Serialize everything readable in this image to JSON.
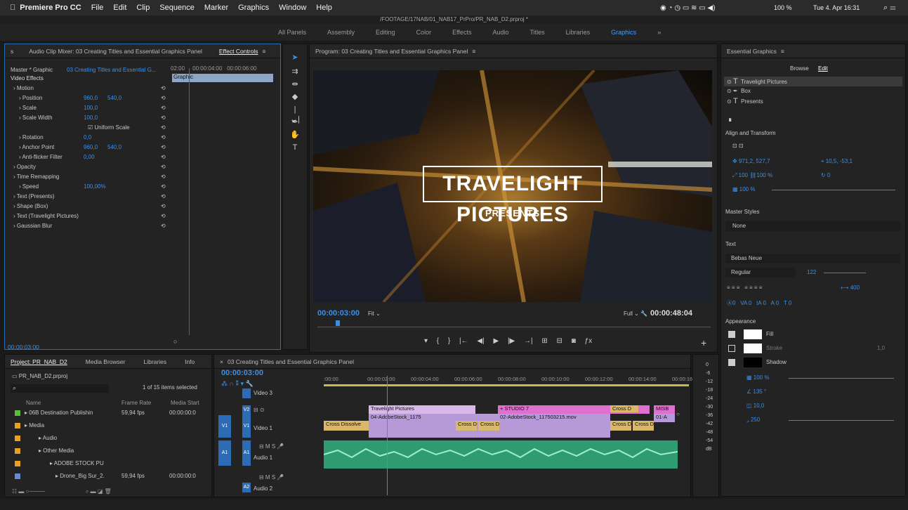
{
  "menubar": {
    "apple": "",
    "app": "Premiere Pro CC",
    "items": [
      "File",
      "Edit",
      "Clip",
      "Sequence",
      "Marker",
      "Graphics",
      "Window",
      "Help"
    ],
    "status": "100 %",
    "datetime": "Tue 4. Apr 16:31"
  },
  "titlebar": {
    "path": "/FOOTAGE/17NAB/01_NAB17_PrPro/PR_NAB_D2.prproj *"
  },
  "workspaces": [
    "All Panels",
    "Assembly",
    "Editing",
    "Color",
    "Effects",
    "Audio",
    "Titles",
    "Libraries",
    "Graphics"
  ],
  "effect_controls": {
    "tabs": [
      "s",
      "Audio Clip Mixer: 03 Creating Titles and Essential Graphics Panel",
      "Effect Controls"
    ],
    "master": "Master * Graphic",
    "seq": "03 Creating Titles and Essential G...",
    "times": [
      "02:00",
      "00:00:04:00",
      "00:00:06:00"
    ],
    "clip_label": "Graphic",
    "section": "Video Effects",
    "rows": [
      {
        "label": "Motion",
        "v1": "",
        "v2": ""
      },
      {
        "label": "Position",
        "v1": "960,0",
        "v2": "540,0"
      },
      {
        "label": "Scale",
        "v1": "100,0",
        "v2": ""
      },
      {
        "label": "Scale Width",
        "v1": "100,0",
        "v2": ""
      },
      {
        "label": "",
        "v1": "Uniform Scale",
        "v2": ""
      },
      {
        "label": "Rotation",
        "v1": "0,0",
        "v2": ""
      },
      {
        "label": "Anchor Point",
        "v1": "960,0",
        "v2": "540,0"
      },
      {
        "label": "Anti-flicker Filter",
        "v1": "0,00",
        "v2": ""
      },
      {
        "label": "Opacity",
        "v1": "",
        "v2": ""
      },
      {
        "label": "Time Remapping",
        "v1": "",
        "v2": ""
      },
      {
        "label": "Speed",
        "v1": "100,00%",
        "v2": ""
      },
      {
        "label": "Text (Presents)",
        "v1": "",
        "v2": ""
      },
      {
        "label": "Shape (Box)",
        "v1": "",
        "v2": ""
      },
      {
        "label": "Text (Travelight Pictures)",
        "v1": "",
        "v2": ""
      },
      {
        "label": "Gaussian Blur",
        "v1": "",
        "v2": ""
      }
    ],
    "timecode": "00:00:03:00"
  },
  "program": {
    "title": "Program: 03 Creating Titles and Essential Graphics Panel",
    "title_text": "TRAVELIGHT PICTURES",
    "sub_text": "PRESENTS",
    "timecode": "00:00:03:00",
    "fit": "Fit",
    "full": "Full",
    "duration": "00:00:48:04"
  },
  "essential": {
    "title": "Essential Graphics",
    "tabs": [
      "Browse",
      "Edit"
    ],
    "layers": [
      "Travelight Pictures",
      "Box",
      "Presents"
    ],
    "align_title": "Align and Transform",
    "pos": [
      "971,2",
      "527,7"
    ],
    "anchor": [
      "10,5",
      "-53,1"
    ],
    "scale": "100",
    "scale2": "100",
    "pct": "%",
    "rot": "0",
    "opacity": "100 %",
    "master_styles": "Master Styles",
    "style_val": "None",
    "text_title": "Text",
    "font": "Bebas Neue",
    "weight": "Regular",
    "size": "122",
    "tracking": "400",
    "kern": [
      "0",
      "0",
      "0",
      "0",
      "0"
    ],
    "appearance": "Appearance",
    "fill": "Fill",
    "stroke": "Stroke",
    "stroke_w": "1,0",
    "shadow": "Shadow",
    "shadow_vals": [
      "100 %",
      "135 °",
      "10,0",
      "250"
    ]
  },
  "project": {
    "tabs": [
      "Project: PR_NAB_D2",
      "Media Browser",
      "Libraries",
      "Info"
    ],
    "file": "PR_NAB_D2.prproj",
    "count": "1 of 15 items selected",
    "cols": [
      "Name",
      "Frame Rate",
      "Media Start"
    ],
    "items": [
      {
        "name": "06B Destination Publishin",
        "rate": "59,94 fps",
        "start": "00:00:00:0",
        "color": "#5bbd3a"
      },
      {
        "name": "Media",
        "rate": "",
        "start": "",
        "color": "#e8a020"
      },
      {
        "name": "Audio",
        "rate": "",
        "start": "",
        "color": "#e8a020"
      },
      {
        "name": "Other Media",
        "rate": "",
        "start": "",
        "color": "#e8a020"
      },
      {
        "name": "ADOBE STOCK PU",
        "rate": "",
        "start": "",
        "color": "#e8a020"
      },
      {
        "name": "Drone_Big Sur_2.",
        "rate": "59,94 fps",
        "start": "00:00:00:0",
        "color": "#6a8ad8"
      }
    ]
  },
  "timeline": {
    "title": "03 Creating Titles and Essential Graphics Panel",
    "timecode": "00:00:03:00",
    "ruler": [
      ":00:00",
      "00:00:02:00",
      "00:00:04:00",
      "00:00:06:00",
      "00:00:08:00",
      "00:00:10:00",
      "00:00:12:00",
      "00:00:14:00",
      "00:00:16:"
    ],
    "tracks": [
      "Video 3",
      "",
      "Video 1",
      "Audio 1",
      "Audio 2"
    ],
    "clips": [
      "Travelight Pictures",
      "04-AdobeStock_1175",
      "+ STUDIO 7",
      "02-AdobeStock_117503215.mov",
      "Cross Dissolve",
      "Cross D",
      "Cross D",
      "Cross D",
      "Cross D",
      "MISB",
      "01-A",
      "Cross D"
    ],
    "meter": [
      "0",
      "-6",
      "-12",
      "-18",
      "-24",
      "-30",
      "-36",
      "-42",
      "-48",
      "-54",
      "dB"
    ]
  }
}
